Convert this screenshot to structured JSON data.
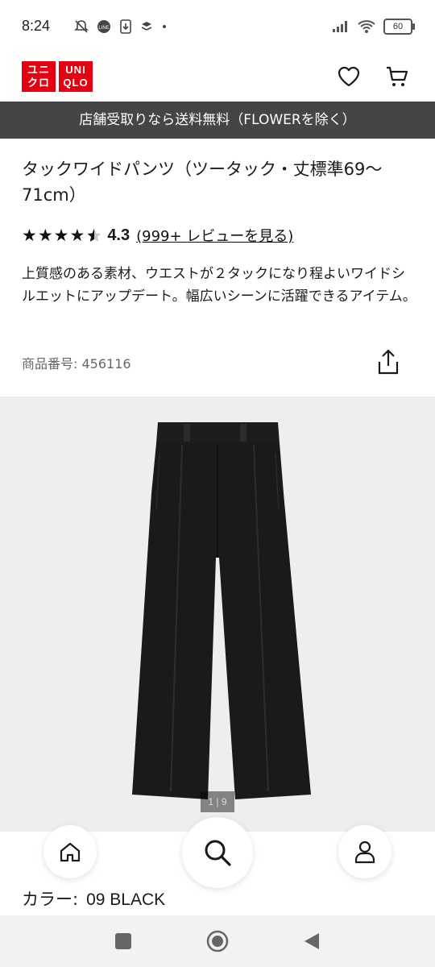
{
  "status_bar": {
    "time": "8:24",
    "battery": "60",
    "icons_left": [
      "mute-icon",
      "line-app-icon",
      "download-icon",
      "layers-icon",
      "dot-icon"
    ],
    "icons_right": [
      "signal-icon",
      "wifi-icon",
      "battery-icon"
    ]
  },
  "header": {
    "logo_text_left": [
      "ユニ",
      "クロ"
    ],
    "logo_text_right": [
      "UNI",
      "QLO"
    ],
    "icons": [
      "heart-icon",
      "cart-icon"
    ]
  },
  "promo_banner": {
    "text": "店舗受取りなら送料無料（FLOWERを除く）"
  },
  "product": {
    "title": "タックワイドパンツ（ツータック・丈標準69〜71cm）",
    "rating": 4.3,
    "stars": "★★★★",
    "rating_text": "4.3",
    "review_link": "(999+ レビューを見る)",
    "description": "上質感のある素材、ウエストが２タックになり程よいワイドシルエットにアップデート。幅広いシーンに活躍できるアイテム。",
    "sku_label": "商品番号: 456116",
    "share_icon": "share-icon"
  },
  "image_viewer": {
    "pager": "1 | 9",
    "image_description": "black-wide-pants"
  },
  "bottom_nav": {
    "items": [
      "home-icon",
      "search-icon",
      "account-icon"
    ]
  },
  "color": {
    "label": "カラー:",
    "value": "09 BLACK"
  },
  "system_nav": {
    "items": [
      "recents-icon",
      "home-circle-icon",
      "back-icon"
    ]
  },
  "colors": {
    "brand_red": "#e60012",
    "banner_bg": "#454545",
    "image_bg": "#eeeeee"
  }
}
